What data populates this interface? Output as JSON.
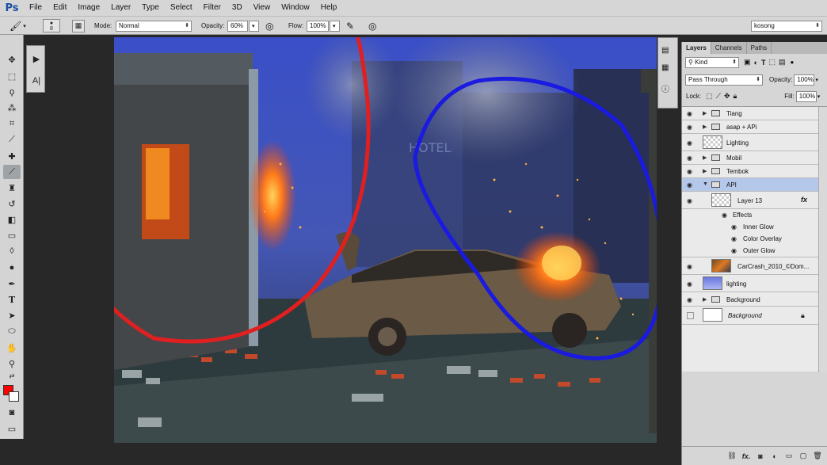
{
  "app": {
    "logo": "Ps"
  },
  "menu": [
    "File",
    "Edit",
    "Image",
    "Layer",
    "Type",
    "Select",
    "Filter",
    "3D",
    "View",
    "Window",
    "Help"
  ],
  "options": {
    "brush_size": "8",
    "mode_label": "Mode:",
    "mode_value": "Normal",
    "opacity_label": "Opacity:",
    "opacity_value": "60%",
    "flow_label": "Flow:",
    "flow_value": "100%",
    "preset_value": "kosong"
  },
  "layers_panel": {
    "tabs": [
      "Layers",
      "Channels",
      "Paths"
    ],
    "kind": "Kind",
    "blend_mode": "Pass Through",
    "opacity_label": "Opacity:",
    "opacity_value": "100%",
    "lock_label": "Lock:",
    "fill_label": "Fill:",
    "fill_value": "100%",
    "layers": [
      {
        "name": "Tiang",
        "type": "group"
      },
      {
        "name": "asap + APi",
        "type": "group"
      },
      {
        "name": "Lighting",
        "type": "layer"
      },
      {
        "name": "Mobil",
        "type": "group"
      },
      {
        "name": "Tembok",
        "type": "group"
      },
      {
        "name": "API",
        "type": "group-open"
      },
      {
        "name": "Layer 13",
        "type": "layer",
        "fx": "fx"
      },
      {
        "name": "Effects",
        "type": "effects"
      },
      {
        "name": "Inner Glow",
        "type": "effect"
      },
      {
        "name": "Color Overlay",
        "type": "effect"
      },
      {
        "name": "Outer Glow",
        "type": "effect"
      },
      {
        "name": "CarCrash_2010_©Dom...",
        "type": "layer"
      },
      {
        "name": "lighting",
        "type": "layer"
      },
      {
        "name": "Background",
        "type": "group"
      },
      {
        "name": "Background",
        "type": "background"
      }
    ]
  },
  "canvas": {
    "sign_text": "HOTEL"
  },
  "colors": {
    "foreground": "#ff0000",
    "background": "#ffffff",
    "red_annotation": "#e02020",
    "blue_annotation": "#1a1ae0",
    "selected_layer": "#b5c8ea"
  }
}
